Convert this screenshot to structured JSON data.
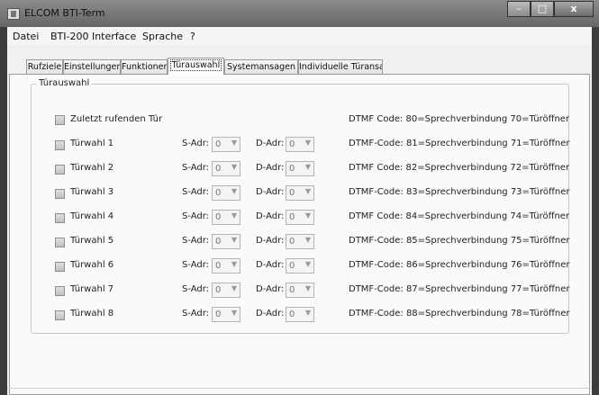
{
  "window": {
    "title": "ELCOM BTI-Term",
    "minimize": "–",
    "maximize": "□",
    "close": "x"
  },
  "menu": [
    "Datei",
    "BTI-200 Interface",
    "Sprache",
    "?"
  ],
  "tabs": [
    "Rufziele",
    "Einstellungen",
    "Funktionen",
    "Türauswahl",
    "Systemansagen",
    "Individuelle Türansagen"
  ],
  "active_tab": "Türauswahl",
  "group_label": "Türauswahl",
  "last_caller": {
    "label": "Zuletzt rufenden Tür",
    "dtmf": "DTMF Code: 80=Sprechverbindung  70=Türöffner"
  },
  "labels": {
    "s_adr": "S-Adr:",
    "d_adr": "D-Adr:"
  },
  "doors": [
    {
      "label": "Türwahl 1",
      "s_value": "0",
      "d_value": "0",
      "dtmf": "DTMF-Code: 81=Sprechverbindung  71=Türöffner"
    },
    {
      "label": "Türwahl 2",
      "s_value": "0",
      "d_value": "0",
      "dtmf": "DTMF Code: 82=Sprechverbindung  72=Türöffner"
    },
    {
      "label": "Türwahl 3",
      "s_value": "0",
      "d_value": "0",
      "dtmf": "DTMF-Code: 83=Sprechverbindung  73=Türöffner"
    },
    {
      "label": "Türwahl 4",
      "s_value": "0",
      "d_value": "0",
      "dtmf": "DTMF Code: 84=Sprechverbindung  74=Türöffner"
    },
    {
      "label": "Türwahl 5",
      "s_value": "0",
      "d_value": "0",
      "dtmf": "DTMF-Code: 85=Sprechverbindung  75=Türöffner"
    },
    {
      "label": "Türwahl 6",
      "s_value": "0",
      "d_value": "0",
      "dtmf": "DTMF-Code: 86=Sprechverbindung  76=Türöffner"
    },
    {
      "label": "Türwahl 7",
      "s_value": "0",
      "d_value": "0",
      "dtmf": "DTMF-Code: 87=Sprechverbindung  77=Türöffner"
    },
    {
      "label": "Türwahl 8",
      "s_value": "0",
      "d_value": "0",
      "dtmf": "DTMF-Code: 88=Sprechverbindung  78=Türöffner"
    }
  ]
}
